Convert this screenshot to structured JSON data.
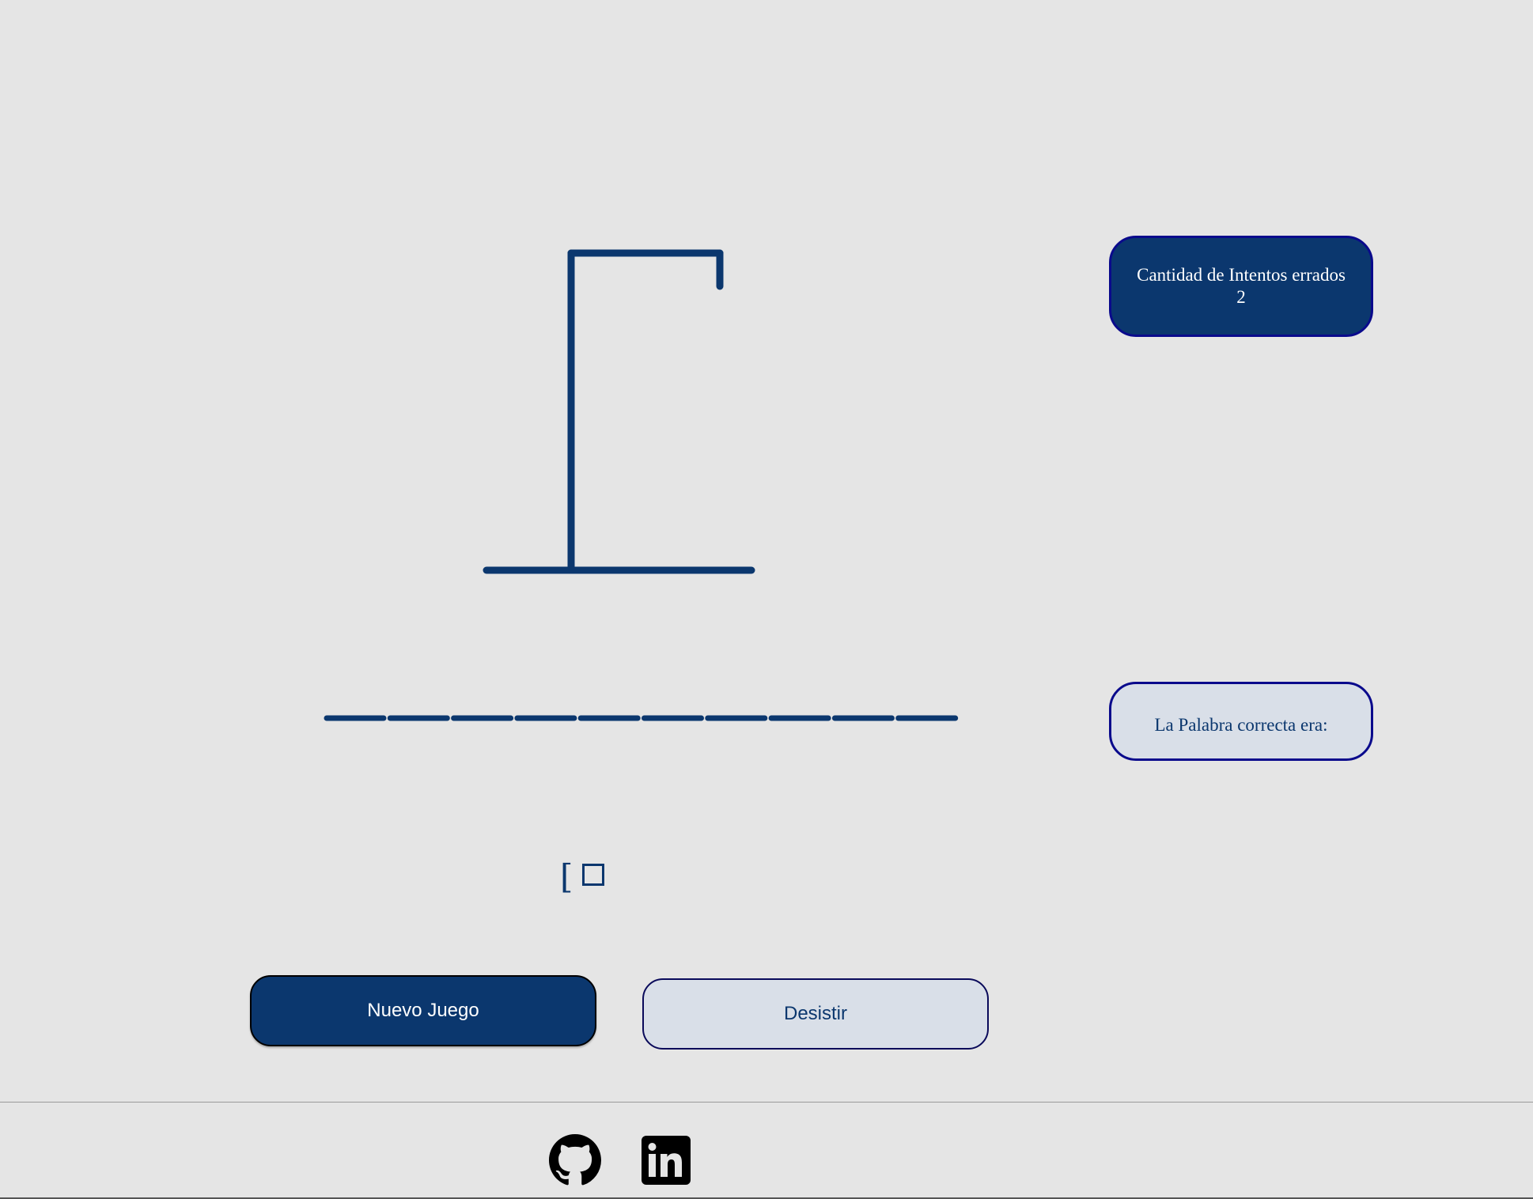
{
  "game": {
    "wrong_attempts_label": "Cantidad de Intentos errados",
    "wrong_attempts_count": "2",
    "correct_word_label": "La Palabra correcta era:",
    "correct_word_value": "",
    "word_slot_count": 10,
    "typed_letters": [
      "[",
      "□"
    ]
  },
  "buttons": {
    "new_game": "Nuevo Juego",
    "give_up": "Desistir"
  },
  "footer": {
    "icons": [
      "github-icon",
      "linkedin-icon"
    ]
  },
  "colors": {
    "primary": "#0b376e",
    "background": "#e5e5e5",
    "light_fill": "#d9dfe8",
    "box_border": "#0a0a8c"
  }
}
